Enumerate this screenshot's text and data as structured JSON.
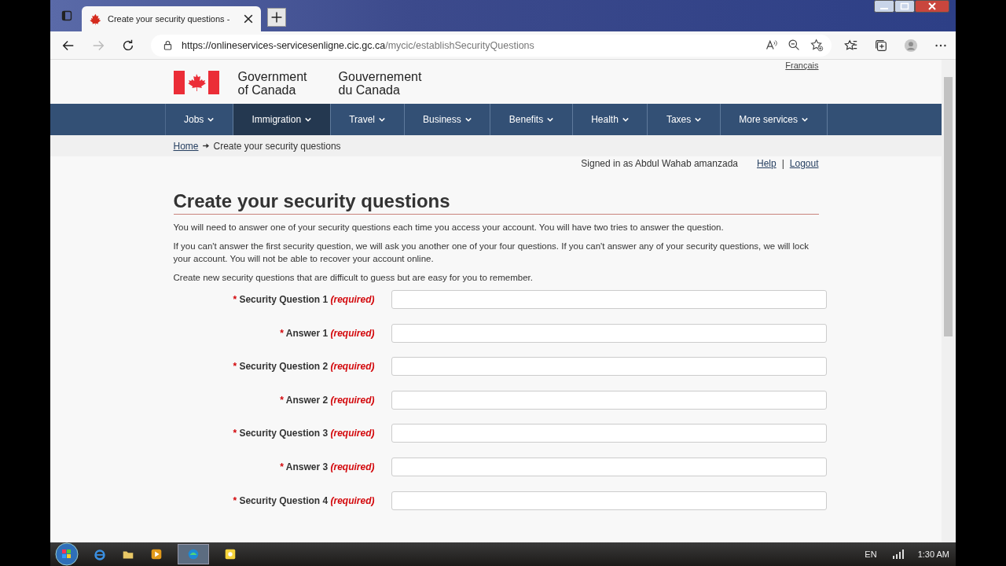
{
  "browser": {
    "tab_title": "Create your security questions - ",
    "url_host": "https://onlineservices-servicesenligne.cic.gc.ca",
    "url_path": "/mycic/establishSecurityQuestions"
  },
  "header": {
    "language_link": "Français",
    "signature_en": [
      "Government",
      "of Canada"
    ],
    "signature_fr": [
      "Gouvernement",
      "du Canada"
    ]
  },
  "nav": [
    {
      "label": "Jobs",
      "selected": false
    },
    {
      "label": "Immigration",
      "selected": true
    },
    {
      "label": "Travel",
      "selected": false
    },
    {
      "label": "Business",
      "selected": false
    },
    {
      "label": "Benefits",
      "selected": false
    },
    {
      "label": "Health",
      "selected": false
    },
    {
      "label": "Taxes",
      "selected": false
    },
    {
      "label": "More services",
      "selected": false
    }
  ],
  "breadcrumb": {
    "home": "Home",
    "current": "Create your security questions"
  },
  "account": {
    "signed_in": "Signed in as Abdul Wahab amanzada",
    "help": "Help",
    "separator": "|",
    "logout": "Logout"
  },
  "heading": "Create your security questions",
  "paragraphs": [
    "You will need to answer one of your security questions each time you access your account. You will have two tries to answer the question.",
    "If you can't answer the first security question, we will ask you another one of your four questions. If you can't answer any of your security questions, we will lock your account.  You will not be able to recover your account online.",
    "Create new security questions that are difficult to guess but are easy for you to remember."
  ],
  "fields": [
    {
      "marker": "*",
      "label": "Security Question 1",
      "required": "(required)"
    },
    {
      "marker": "*",
      "label": "Answer 1",
      "required": "(required)"
    },
    {
      "marker": "*",
      "label": "Security Question 2",
      "required": "(required)"
    },
    {
      "marker": "*",
      "label": "Answer 2",
      "required": "(required)"
    },
    {
      "marker": "*",
      "label": "Security Question 3",
      "required": "(required)"
    },
    {
      "marker": "*",
      "label": "Answer 3",
      "required": "(required)"
    },
    {
      "marker": "*",
      "label": "Security Question 4",
      "required": "(required)"
    }
  ],
  "taskbar": {
    "language": "EN",
    "time": "1:30 AM"
  }
}
